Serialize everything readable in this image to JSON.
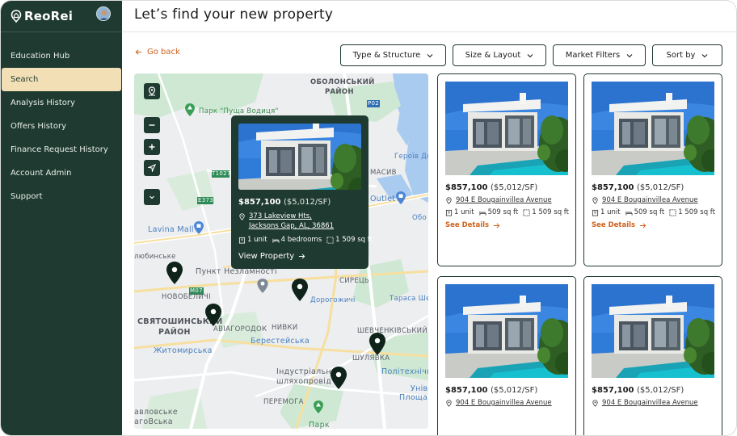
{
  "app": {
    "name": "ReoRei"
  },
  "sidebar": {
    "items": [
      {
        "label": "Education Hub"
      },
      {
        "label": "Search",
        "active": true
      },
      {
        "label": "Analysis History"
      },
      {
        "label": "Offers History"
      },
      {
        "label": "Finance Request History"
      },
      {
        "label": "Account Admin"
      },
      {
        "label": "Support"
      }
    ]
  },
  "header": {
    "title": "Let’s find your new property"
  },
  "nav": {
    "go_back": "Go back"
  },
  "filters": {
    "type_structure": "Type & Structure",
    "size_layout": "Size & Layout",
    "market_filters": "Market Filters",
    "sort_by": "Sort by"
  },
  "map": {
    "labels": {
      "obolonskyi": "ОБОЛОНСЬКИЙ",
      "raion1": "РАЙОН",
      "park_pushcha": "Парк \"Пуща Водиця\"",
      "heroiv": "Героїв Дн",
      "masyv": "МАСИВ",
      "lavina": "Lavina Mall",
      "outlet": "Outlet",
      "obo": "Обо",
      "lyubinske": "любинське",
      "punkt": "Пункт Незламності",
      "syrets": "СИРЕЦЬ",
      "dorohozhychi": "Дорогожичі",
      "tarasa": "Тараса Ше",
      "novobelychi": "НОВОБЕЛИЧІ",
      "sviatoshynskyi": "СВЯТОШИНСЬКИЙ",
      "raion2": "РАЙОН",
      "aviahorodok": "АВІАГОРОДОК",
      "nyvky": "НИВКИ",
      "shevchenkivskyi": "ШЕВЧЕНКІВСЬКИЙ",
      "zhytomyrska": "Житомирська",
      "beresteiska": "Берестейська",
      "shuliavka": "ШУЛЯВКА",
      "politekhnichni": "Політехнічні",
      "industrialnyi": "Індустріальний",
      "shliakhoprovid": "шляхопровід",
      "univ": "Унів",
      "ploshcha": "Площа",
      "peremoha": "ПЕРЕМОГА",
      "avlovske": "авловське",
      "hahovska": "агоВська",
      "park": "Парк",
      "road_t1027": "T1027",
      "road_e373": "E373",
      "road_p02": "P02",
      "road_m07": "M07"
    }
  },
  "popup": {
    "price": "$857,100",
    "price_per_sf": "($5,012/SF)",
    "address_line1": "373 Lakeview Hts,",
    "address_line2": "Jacksons Gap, AL, 36861",
    "units": "1 unit",
    "bedrooms": "4 bedrooms",
    "sqft": "1 509 sq ft",
    "link": "View Property"
  },
  "cards": [
    {
      "price": "$857,100",
      "price_per_sf": "($5,012/SF)",
      "address": "904 E Bougainvillea Avenue",
      "units": "1 unit",
      "sqft1": "509 sq ft",
      "sqft2": "1 509 sq ft",
      "link": "See Details"
    },
    {
      "price": "$857,100",
      "price_per_sf": "($5,012/SF)",
      "address": "904 E Bougainvillea Avenue",
      "units": "1 unit",
      "sqft1": "509 sq ft",
      "sqft2": "1 509 sq ft",
      "link": "See Details"
    },
    {
      "price": "$857,100",
      "price_per_sf": "($5,012/SF)",
      "address": "904 E Bougainvillea Avenue"
    },
    {
      "price": "$857,100",
      "price_per_sf": "($5,012/SF)",
      "address": "904 E Bougainvillea Avenue"
    }
  ],
  "colors": {
    "sidebar": "#1f3a30",
    "active": "#f3dfb6",
    "accent": "#d0611b"
  }
}
